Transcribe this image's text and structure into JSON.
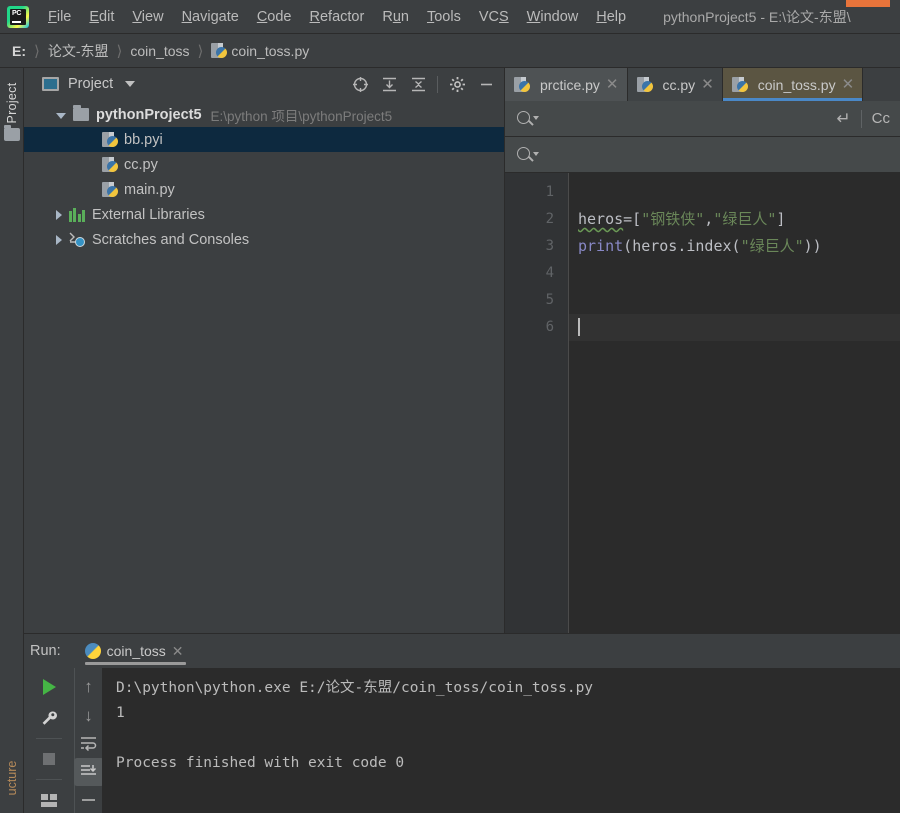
{
  "window": {
    "title": "pythonProject5 - E:\\论文-东盟\\",
    "app_logo": "pycharm-logo"
  },
  "menubar": {
    "items": [
      {
        "label": "File",
        "mnemonic": "F"
      },
      {
        "label": "Edit",
        "mnemonic": "E"
      },
      {
        "label": "View",
        "mnemonic": "V"
      },
      {
        "label": "Navigate",
        "mnemonic": "N"
      },
      {
        "label": "Code",
        "mnemonic": "C"
      },
      {
        "label": "Refactor",
        "mnemonic": "R"
      },
      {
        "label": "Run",
        "mnemonic": "u"
      },
      {
        "label": "Tools",
        "mnemonic": "T"
      },
      {
        "label": "VCS",
        "mnemonic": "S"
      },
      {
        "label": "Window",
        "mnemonic": "W"
      },
      {
        "label": "Help",
        "mnemonic": "H"
      }
    ]
  },
  "breadcrumb": {
    "segments": [
      "E:",
      "论文-东盟",
      "coin_toss",
      "coin_toss.py"
    ],
    "separator": "〉"
  },
  "left_strip": {
    "project_tab": "Project",
    "structure_tab": "ucture"
  },
  "project_panel": {
    "title": "Project",
    "tools": [
      "locate-icon",
      "expand-all-icon",
      "collapse-all-icon",
      "gear-icon",
      "hide-icon"
    ],
    "tree": [
      {
        "label": "pythonProject5",
        "detail": "E:\\python 项目\\pythonProject5",
        "icon": "folder-icon",
        "indent": 0,
        "expanded": true,
        "selected": false,
        "bold": true
      },
      {
        "label": "bb.pyi",
        "detail": "",
        "icon": "python-file-icon",
        "indent": 1,
        "expanded": null,
        "selected": true,
        "bold": false
      },
      {
        "label": "cc.py",
        "detail": "",
        "icon": "python-file-icon",
        "indent": 1,
        "expanded": null,
        "selected": false,
        "bold": false
      },
      {
        "label": "main.py",
        "detail": "",
        "icon": "python-file-icon",
        "indent": 1,
        "expanded": null,
        "selected": false,
        "bold": false
      },
      {
        "label": "External Libraries",
        "detail": "",
        "icon": "library-icon",
        "indent": 0,
        "expanded": false,
        "selected": false,
        "bold": false
      },
      {
        "label": "Scratches and Consoles",
        "detail": "",
        "icon": "scratches-icon",
        "indent": 0,
        "expanded": false,
        "selected": false,
        "bold": false
      }
    ]
  },
  "editor": {
    "tabs": [
      {
        "label": "prctice.py",
        "active": false
      },
      {
        "label": "cc.py",
        "active": false
      },
      {
        "label": "coin_toss.py",
        "active": true
      }
    ],
    "find_bar": {
      "value": "",
      "placeholder": "",
      "match_case_label": "Cc",
      "return_icon": "return-icon"
    },
    "replace_bar": {
      "value": "",
      "placeholder": ""
    },
    "line_numbers": [
      "1",
      "2",
      "3",
      "4",
      "5",
      "6"
    ],
    "code": {
      "line1": "",
      "line2": {
        "var": "heros",
        "op": "=[",
        "str1": "\"钢铁侠\"",
        "comma": ",",
        "str2": "\"绿巨人\"",
        "close": "]"
      },
      "line3": {
        "fn": "print",
        "open": "(",
        "var": "heros",
        "dot": ".index(",
        "str": "\"绿巨人\"",
        "close": "))"
      },
      "line4": "",
      "line5": "",
      "line6": ""
    },
    "caret_line": 6
  },
  "run_panel": {
    "label": "Run:",
    "tab_label": "coin_toss",
    "tools_left": [
      "run-icon",
      "wrench-icon",
      "stop-icon",
      "layout-icon"
    ],
    "tools_right": [
      "arrow-up-icon",
      "arrow-down-icon",
      "soft-wrap-icon",
      "scroll-to-end-icon"
    ],
    "console_lines": [
      "D:\\python\\python.exe E:/论文-东盟/coin_toss/coin_toss.py",
      "1",
      "",
      "Process finished with exit code 0"
    ]
  },
  "colors": {
    "bg": "#3c3f41",
    "editor_bg": "#2b2b2b",
    "accent_blue": "#4a88c7",
    "selection": "#0d293f",
    "string_green": "#6a8759",
    "keyword_violet": "#8888c6",
    "run_green": "#45b545",
    "title_orange": "#e8743b"
  }
}
